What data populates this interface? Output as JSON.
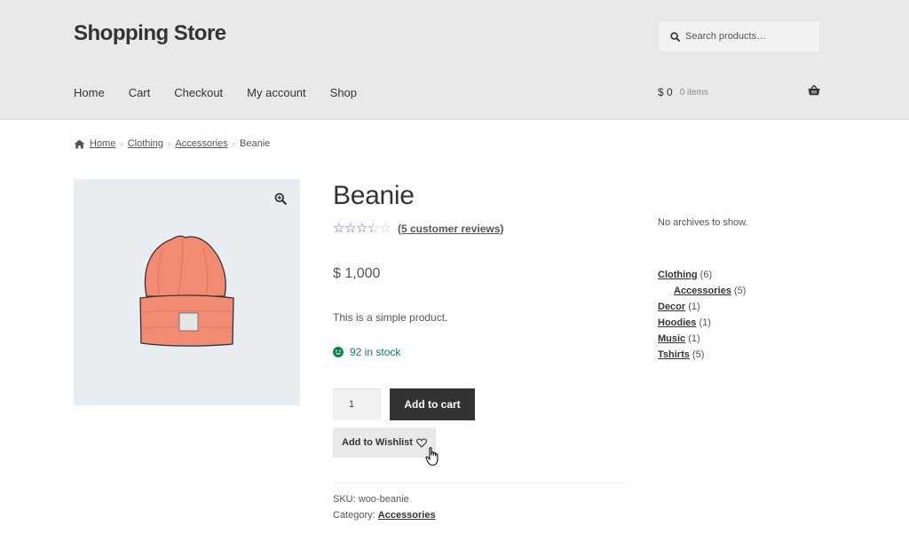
{
  "header": {
    "site_title": "Shopping Store",
    "search_placeholder": "Search products…",
    "nav": [
      "Home",
      "Cart",
      "Checkout",
      "My account",
      "Shop"
    ],
    "cart_total": "$ 0",
    "cart_items": "0 items"
  },
  "breadcrumb": [
    "Home",
    "Clothing",
    "Accessories",
    "Beanie"
  ],
  "product": {
    "title": "Beanie",
    "rating": 3.5,
    "rating_max": 5,
    "reviews_link": "(5 customer reviews)",
    "price": "$ 1,000",
    "description": "This is a simple product.",
    "stock": "92 in stock",
    "quantity": "1",
    "add_to_cart": "Add to cart",
    "wishlist": "Add to Wishlist",
    "sku_label": "SKU:",
    "sku": "woo-beanie",
    "category_label": "Category:",
    "category": "Accessories"
  },
  "sidebar": {
    "archives": "No archives to show.",
    "categories": [
      {
        "name": "Clothing",
        "count": "(6)",
        "sub": false
      },
      {
        "name": "Accessories",
        "count": "(5)",
        "sub": true
      },
      {
        "name": "Decor",
        "count": "(1)",
        "sub": false
      },
      {
        "name": "Hoodies",
        "count": "(1)",
        "sub": false
      },
      {
        "name": "Music",
        "count": "(1)",
        "sub": false
      },
      {
        "name": "Tshirts",
        "count": "(5)",
        "sub": false
      }
    ]
  },
  "colors": {
    "header_bg": "#e9e9e9",
    "accent_star": "#7f54b3",
    "stock_green": "#0f834d",
    "button_dark": "#333333"
  },
  "icons": [
    "search-icon",
    "basket-icon",
    "home-icon",
    "zoom-icon",
    "star-icon",
    "smiley-icon",
    "heart-icon",
    "hand-cursor-icon"
  ]
}
